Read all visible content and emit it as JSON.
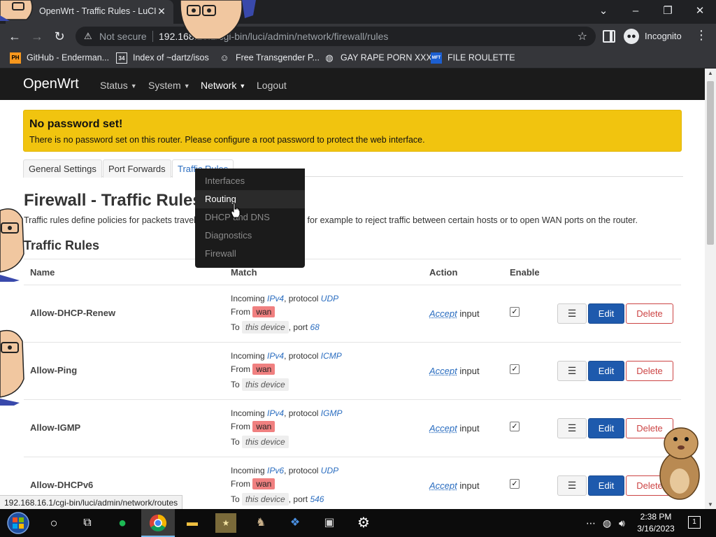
{
  "browser": {
    "tab_title": "OpenWrt - Traffic Rules - LuCI",
    "address_security": "Not secure",
    "address_host": "192.168.16.1",
    "address_path": "/cgi-bin/luci/admin/network/firewall/rules",
    "incognito_label": "Incognito",
    "bookmarks": [
      {
        "label": "GitHub - Enderman...",
        "icon": "PH"
      },
      {
        "label": "Index of ~dartz/isos",
        "icon": "34"
      },
      {
        "label": "Free Transgender P...",
        "icon": "mask"
      },
      {
        "label": "GAY RAPE PORN XXX",
        "icon": "globe"
      },
      {
        "label": "FILE ROULETTE",
        "icon": "MFT"
      }
    ],
    "status_url": "192.168.16.1/cgi-bin/luci/admin/network/routes"
  },
  "luci": {
    "brand": "OpenWrt",
    "menu": [
      "Status",
      "System",
      "Network",
      "Logout"
    ],
    "network_dropdown": [
      "Interfaces",
      "Routing",
      "DHCP and DNS",
      "Diagnostics",
      "Firewall"
    ],
    "alert_title": "No password set!",
    "alert_text": "There is no password set on this router. Please configure a root password to protect the web interface.",
    "tabs": [
      "General Settings",
      "Port Forwards",
      "Traffic Rules"
    ],
    "page_title": "Firewall - Traffic Rules",
    "page_desc": "Traffic rules define policies for packets traveling between different zones, for example to reject traffic between certain hosts or to open WAN ports on the router.",
    "section_title": "Traffic Rules",
    "columns": [
      "Name",
      "Match",
      "Action",
      "Enable"
    ],
    "rules": [
      {
        "name": "Allow-DHCP-Renew",
        "family": "IPv4",
        "protocol": "UDP",
        "from": "wan",
        "to": "this device",
        "port": "68",
        "action": "Accept",
        "action_target": "input"
      },
      {
        "name": "Allow-Ping",
        "family": "IPv4",
        "protocol": "ICMP",
        "from": "wan",
        "to": "this device",
        "port": "",
        "action": "Accept",
        "action_target": "input"
      },
      {
        "name": "Allow-IGMP",
        "family": "IPv4",
        "protocol": "IGMP",
        "from": "wan",
        "to": "this device",
        "port": "",
        "action": "Accept",
        "action_target": "input"
      },
      {
        "name": "Allow-DHCPv6",
        "family": "IPv6",
        "protocol": "UDP",
        "from": "wan",
        "to": "this device",
        "port": "546",
        "action": "Accept",
        "action_target": "input"
      }
    ],
    "labels": {
      "incoming": "Incoming",
      "protocol": "protocol",
      "from": "From",
      "to": "To",
      "port": "port",
      "edit": "Edit",
      "delete": "Delete",
      "drag": "☰"
    }
  },
  "taskbar": {
    "time": "2:38 PM",
    "date": "3/16/2023",
    "notifications": "1"
  }
}
